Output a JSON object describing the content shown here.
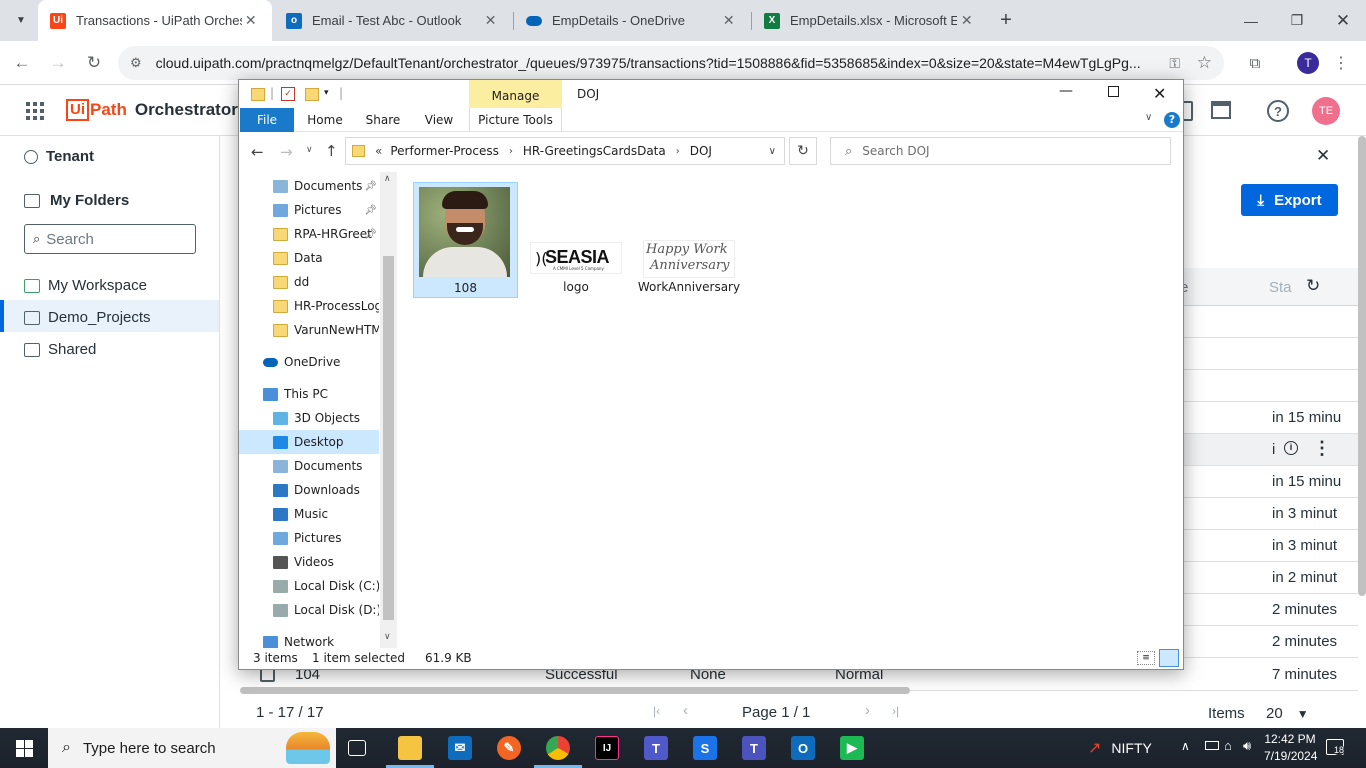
{
  "browser": {
    "tabs": [
      {
        "label": "Transactions - UiPath Orchestra",
        "icon": "uipath-icon",
        "color": "#fa4616"
      },
      {
        "label": "Email - Test Abc - Outlook",
        "icon": "outlook-icon",
        "color": "#0f6cbd"
      },
      {
        "label": "EmpDetails - OneDrive",
        "icon": "onedrive-icon",
        "color": "#0364b8"
      },
      {
        "label": "EmpDetails.xlsx - Microsoft Exce",
        "icon": "excel-icon",
        "color": "#107c41"
      }
    ],
    "new_tab": "+",
    "url": "cloud.uipath.com/practnqmelgz/DefaultTenant/orchestrator_/queues/973975/transactions?tid=1508886&fid=5358685&index=0&size=20&state=M4ewTgLgPg...",
    "profile_initial": "T"
  },
  "app": {
    "logo_text": "Orchestrator",
    "logo_ui": "Ui",
    "logo_path": "Path",
    "avatar": "TE",
    "export_label": "Export",
    "sidebar": {
      "tenant": "Tenant",
      "my_folders": "My Folders",
      "search_placeholder": "Search",
      "items": [
        "My Workspace",
        "Demo_Projects",
        "Shared"
      ]
    },
    "table": {
      "header_e": "e",
      "header_sta": "Sta",
      "times": [
        "in 15 minu",
        "i",
        "in 15 minu",
        "in 3 minut",
        "in 3 minut",
        "in 2 minut",
        "2 minutes",
        "2 minutes",
        "7 minutes"
      ],
      "last_row": {
        "id": "104",
        "status": "Successful",
        "reference": "None",
        "priority": "Normal"
      }
    },
    "pager": {
      "range": "1 - 17 / 17",
      "page": "Page 1 / 1",
      "items_label": "Items",
      "items_value": "20"
    }
  },
  "explorer": {
    "title": "DOJ",
    "manage": "Manage",
    "ribbon_tabs": [
      "File",
      "Home",
      "Share",
      "View",
      "Picture Tools"
    ],
    "breadcrumb_prefix": "«",
    "breadcrumb": [
      "Performer-Process",
      "HR-GreetingsCardsData",
      "DOJ"
    ],
    "search_placeholder": "Search DOJ",
    "tree": [
      {
        "label": "Documents",
        "type": "docs",
        "pinned": true
      },
      {
        "label": "Pictures",
        "type": "pics",
        "pinned": true
      },
      {
        "label": "RPA-HRGreet",
        "type": "folder",
        "pinned": true
      },
      {
        "label": "Data",
        "type": "folder"
      },
      {
        "label": "dd",
        "type": "folder"
      },
      {
        "label": "HR-ProcessLogs",
        "type": "folder"
      },
      {
        "label": "VarunNewHTML",
        "type": "folder"
      },
      {
        "label": "OneDrive",
        "type": "onedrive"
      },
      {
        "label": "This PC",
        "type": "pc"
      },
      {
        "label": "3D Objects",
        "type": "3d"
      },
      {
        "label": "Desktop",
        "type": "desktop",
        "selected": true
      },
      {
        "label": "Documents",
        "type": "docs"
      },
      {
        "label": "Downloads",
        "type": "downloads"
      },
      {
        "label": "Music",
        "type": "music"
      },
      {
        "label": "Pictures",
        "type": "pics"
      },
      {
        "label": "Videos",
        "type": "videos"
      },
      {
        "label": "Local Disk (C:)",
        "type": "disk"
      },
      {
        "label": "Local Disk (D:)",
        "type": "disk"
      },
      {
        "label": "Network",
        "type": "network"
      }
    ],
    "files": [
      {
        "name": "108",
        "kind": "photo",
        "selected": true
      },
      {
        "name": "logo",
        "kind": "logo",
        "logo_text": "SEASIA",
        "logo_sub": "A CMMI Level 5 Company"
      },
      {
        "name": "WorkAnniversary",
        "kind": "card",
        "card_text_1": "Happy Work",
        "card_text_2": "Anniversary"
      }
    ],
    "status": {
      "count": "3 items",
      "selection": "1 item selected",
      "size": "61.9 KB"
    }
  },
  "taskbar": {
    "search_placeholder": "Type here to search",
    "nifty": "NIFTY",
    "time": "12:42 PM",
    "date": "7/19/2024",
    "notifications": "18"
  }
}
